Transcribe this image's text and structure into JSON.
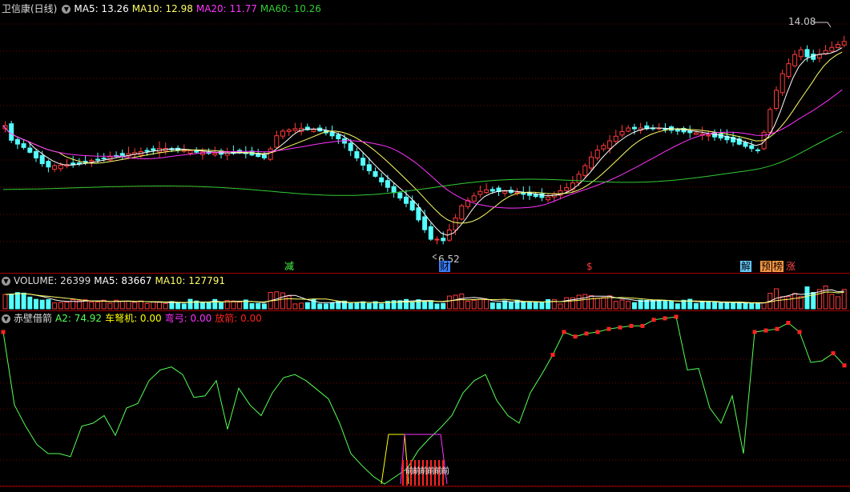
{
  "colors": {
    "up": "#ff3b3b",
    "down": "#54ffff",
    "ma5": "#ffffff",
    "ma10": "#ffff66",
    "ma20": "#ff33ff",
    "ma60": "#33cc33",
    "grid": "#7a0000",
    "yellow": "#ffff00",
    "green": "#55ff55",
    "magenta": "#ff33ff",
    "red": "#ff2222"
  },
  "price_panel": {
    "title": "卫信康(日线)",
    "ma": [
      {
        "label": "MA5: 13.26",
        "color": "#ffffff"
      },
      {
        "label": "MA10: 12.98",
        "color": "#ffff66"
      },
      {
        "label": "MA20: 11.77",
        "color": "#ff33ff"
      },
      {
        "label": "MA60: 10.26",
        "color": "#33cc33"
      }
    ],
    "high_label": "14.08",
    "low_label": "6.52",
    "markers": [
      {
        "text": "减",
        "color": "#44ff44",
        "bg": "#000000"
      },
      {
        "text": "财",
        "color": "#000000",
        "bg": "#3a7fff"
      },
      {
        "text": "$",
        "color": "#ff3b3b",
        "bg": "#000000"
      },
      {
        "text": "解",
        "color": "#000000",
        "bg": "#66ccff"
      },
      {
        "text": "预",
        "color": "#000000",
        "bg": "#ff9944"
      },
      {
        "text": "榜",
        "color": "#000000",
        "bg": "#ff9944"
      },
      {
        "text": "涨",
        "color": "#ff4444",
        "bg": "#000000"
      }
    ]
  },
  "volume_panel": {
    "labels": [
      {
        "label": "VOLUME: 26399",
        "color": "#dddddd"
      },
      {
        "label": "MA5: 83667",
        "color": "#ffffff"
      },
      {
        "label": "MA10: 127791",
        "color": "#ffff66"
      }
    ]
  },
  "indicator_panel": {
    "name": "赤壁借箭",
    "labels": [
      {
        "label": "A2: 74.92",
        "color": "#55ff55"
      },
      {
        "label": "车弩机: 0.00",
        "color": "#ffff00"
      },
      {
        "label": "弯弓: 0.00",
        "color": "#ff33ff"
      },
      {
        "label": "放箭: 0.00",
        "color": "#ff2222"
      }
    ],
    "signal_text": "前前前前前前",
    "a2_values": [
      100,
      52,
      38,
      26,
      20,
      20,
      18,
      38,
      40,
      45,
      32,
      50,
      53,
      68,
      75,
      77,
      72,
      57,
      58,
      68,
      36,
      63,
      52,
      45,
      60,
      70,
      72,
      68,
      62,
      56,
      40,
      20,
      12,
      5,
      0,
      5,
      10,
      22,
      30,
      37,
      45,
      60,
      68,
      72,
      55,
      45,
      40,
      60,
      72,
      85,
      100,
      97,
      99,
      100,
      102,
      103,
      104,
      104,
      108,
      109,
      110,
      75,
      76,
      50,
      40,
      58,
      20,
      100,
      101,
      102,
      106,
      100,
      80,
      81,
      86,
      78
    ],
    "a2_red_idx": [
      0,
      49,
      50,
      51,
      52,
      53,
      54,
      55,
      56,
      57,
      58,
      59,
      60,
      67,
      68,
      69,
      70,
      71,
      74,
      75
    ]
  }
}
